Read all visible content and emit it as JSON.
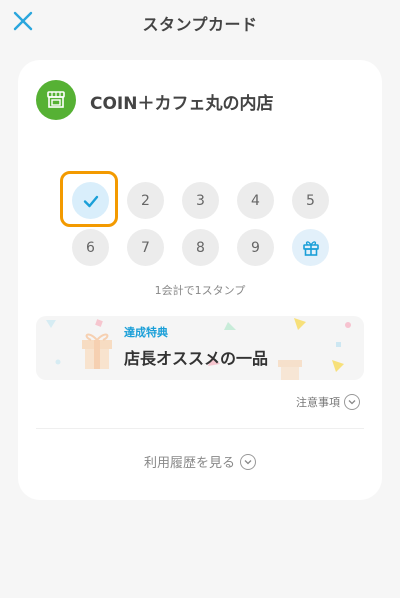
{
  "header": {
    "title": "スタンプカード",
    "close_icon": "close-icon",
    "accent_color": "#2aa6dd"
  },
  "shop": {
    "icon": "shop-icon",
    "icon_color": "#56b134",
    "name": "COIN＋カフェ丸の内店"
  },
  "stamps": {
    "items": [
      {
        "label": "",
        "state": "stamped",
        "icon": "check-icon"
      },
      {
        "label": "2",
        "state": "empty"
      },
      {
        "label": "3",
        "state": "empty"
      },
      {
        "label": "4",
        "state": "empty"
      },
      {
        "label": "5",
        "state": "empty"
      },
      {
        "label": "6",
        "state": "empty"
      },
      {
        "label": "7",
        "state": "empty"
      },
      {
        "label": "8",
        "state": "empty"
      },
      {
        "label": "9",
        "state": "empty"
      },
      {
        "label": "",
        "state": "reward",
        "icon": "gift-icon"
      }
    ],
    "highlight_color": "#f39a00",
    "rule": "1会計で1スタンプ"
  },
  "reward": {
    "label": "達成特典",
    "name": "店長オススメの一品"
  },
  "notes": {
    "label": "注意事項"
  },
  "history": {
    "label": "利用履歴を見る"
  }
}
